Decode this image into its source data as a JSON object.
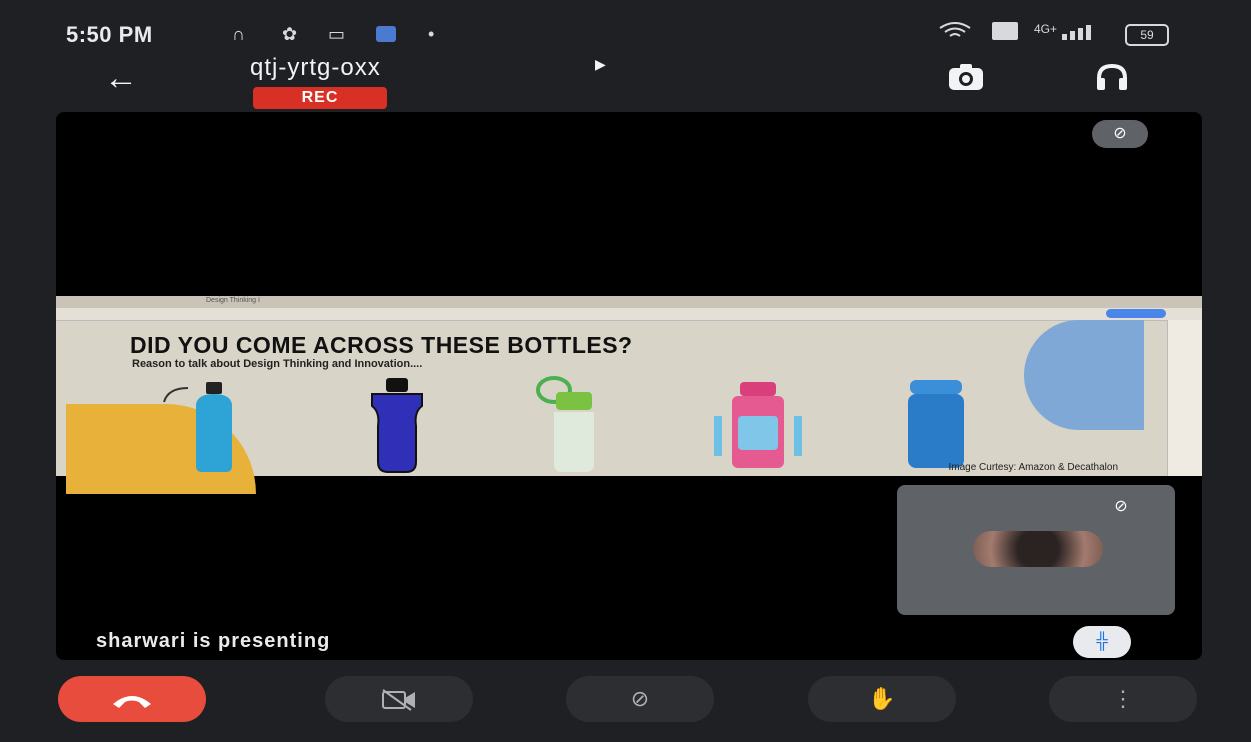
{
  "status_bar": {
    "time": "5:50 PM",
    "battery": "59",
    "signal_text": "4G+",
    "icons": [
      "headphones-icon",
      "settings-icon",
      "cast-icon",
      "app-icon",
      "wifi-icon",
      "volte-icon",
      "signal-icon",
      "battery-icon"
    ]
  },
  "header": {
    "meeting_code": "qtj-yrtg-oxx",
    "rec_label": "REC",
    "back_icon": "arrow-left-icon",
    "switch_camera_icon": "camera-switch-icon",
    "audio_icon": "headphones-icon"
  },
  "slide": {
    "tab_label": "Design Thinking I",
    "title": "DID YOU COME ACROSS THESE BOTTLES?",
    "subtitle": "Reason to talk about Design Thinking and Innovation....",
    "credit": "Image Curtesy: Amazon & Decathalon"
  },
  "presenter": {
    "presenting_text": "sharwari is presenting"
  },
  "controls": {
    "end_call_icon": "phone-hangup-icon",
    "camera_icon": "camera-off-icon",
    "mic_icon": "mic-off-icon",
    "hand_icon": "raise-hand-icon",
    "more_icon": "more-vertical-icon"
  },
  "colors": {
    "background": "#1f2023",
    "rec_red": "#d93025",
    "end_call_red": "#e74c3c",
    "tile_gray": "#5f6368"
  }
}
